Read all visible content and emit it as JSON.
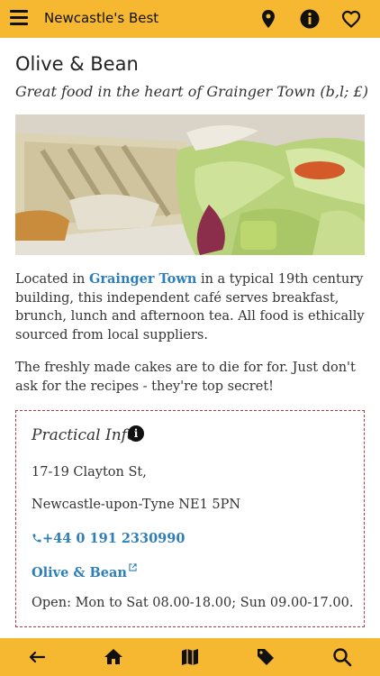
{
  "header": {
    "title": "Newcastle's Best",
    "icons": [
      "menu-icon",
      "location-pin-icon",
      "info-icon",
      "heart-icon"
    ]
  },
  "place": {
    "name": "Olive & Bean",
    "tagline": "Great food in the heart of Grainger Town (b,l; £)",
    "description": {
      "prefix": "Located in ",
      "link": "Grainger Town",
      "suffix": " in a typical 19th century building, this independent café serves breakfast, brunch, lunch and afternoon tea. All food is ethically sourced from local suppliers."
    },
    "extra": "The freshly made cakes are to die for for. Just don't ask for the recipes - they're top secret!"
  },
  "practical_info": {
    "heading": "Practical Info",
    "address_line1": "17-19 Clayton St,",
    "address_line2": "Newcastle-upon-Tyne NE1 5PN",
    "phone": "+44 0 191 2330990",
    "website": "Olive & Bean",
    "opening": "Open: Mon to Sat 08.00-18.00; Sun 09.00-17.00."
  },
  "footer": {
    "icons": [
      "back-arrow-icon",
      "home-icon",
      "map-icon",
      "tag-icon",
      "search-icon"
    ]
  },
  "colors": {
    "bar": "#f6b731",
    "link": "#2e7fb8",
    "box_border": "#b23a48"
  }
}
